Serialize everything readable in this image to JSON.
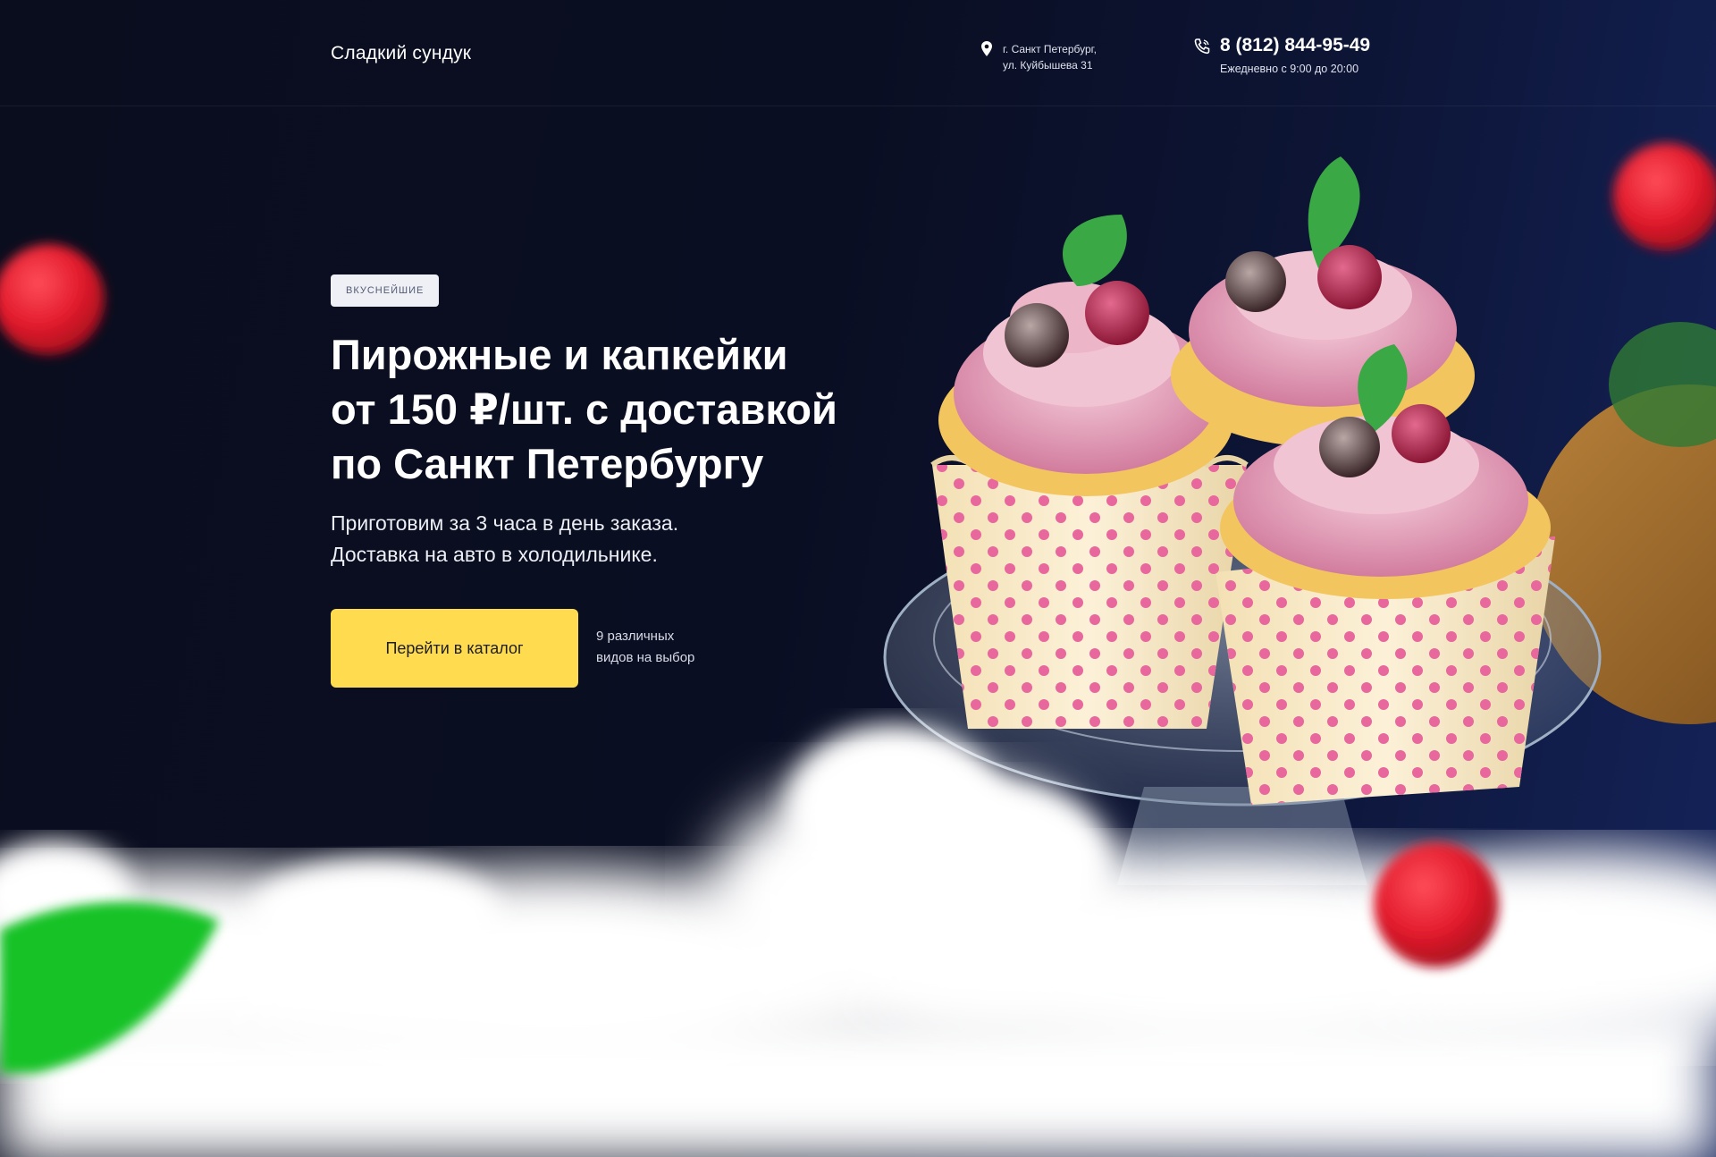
{
  "header": {
    "logo": "Сладкий сундук",
    "address_line1": "г. Санкт Петербург,",
    "address_line2": "ул. Куйбышева 31",
    "phone": "8 (812) 844-95-49",
    "hours": "Ежедневно с 9:00 до 20:00"
  },
  "hero": {
    "badge": "ВКУСНЕЙШИЕ",
    "headline": [
      "Пирожные и капкейки",
      "от 150 ₽/шт. с доставкой",
      "по Санкт Петербургу"
    ],
    "subtitle": [
      "Приготовим за 3 часа в день заказа.",
      "Доставка на авто в холодильнике."
    ],
    "cta_label": "Перейти в каталог",
    "cta_note": [
      "9 различных",
      "видов на выбор"
    ]
  },
  "icons": {
    "address": "location-pin-icon",
    "phone": "phone-icon"
  },
  "colors": {
    "accent": "#fedb4f",
    "background": "#0a0d1e",
    "frosting": "#eaa9c0",
    "polka_dot": "#e8679d"
  }
}
